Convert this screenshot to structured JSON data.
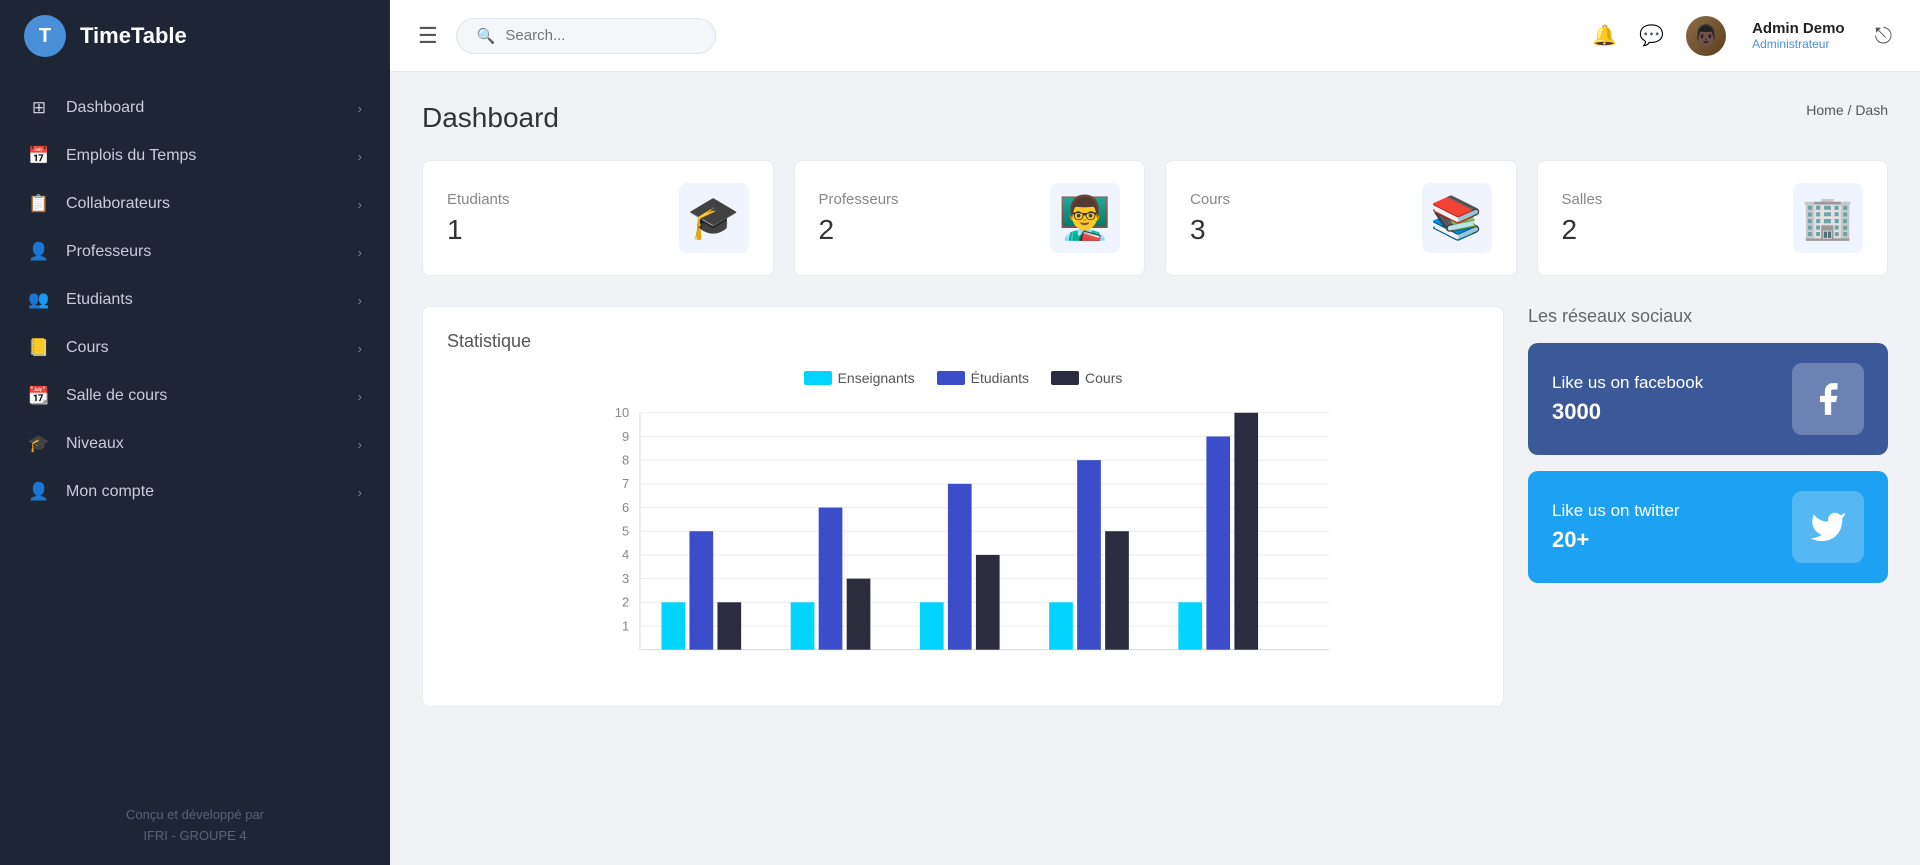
{
  "app": {
    "logo_letter": "T",
    "title": "TimeTable"
  },
  "sidebar": {
    "items": [
      {
        "id": "dashboard",
        "label": "Dashboard",
        "icon": "⊞"
      },
      {
        "id": "emplois",
        "label": "Emplois du Temps",
        "icon": "📅"
      },
      {
        "id": "collaborateurs",
        "label": "Collaborateurs",
        "icon": "📋"
      },
      {
        "id": "professeurs",
        "label": "Professeurs",
        "icon": "👤"
      },
      {
        "id": "etudiants",
        "label": "Etudiants",
        "icon": "👥"
      },
      {
        "id": "cours",
        "label": "Cours",
        "icon": "📒"
      },
      {
        "id": "salle",
        "label": "Salle de cours",
        "icon": "📆"
      },
      {
        "id": "niveaux",
        "label": "Niveaux",
        "icon": "🎓"
      },
      {
        "id": "compte",
        "label": "Mon compte",
        "icon": "👤"
      }
    ],
    "footer_line1": "Conçu et développé par",
    "footer_line2": "IFRI - GROUPE 4"
  },
  "topbar": {
    "search_placeholder": "Search...",
    "user_name": "Admin Demo",
    "user_role": "Administrateur"
  },
  "page": {
    "title": "Dashboard",
    "breadcrumb_home": "Home",
    "breadcrumb_sep": "/",
    "breadcrumb_current": "Dash"
  },
  "stats": [
    {
      "label": "Etudiants",
      "value": "1",
      "emoji": "🎓"
    },
    {
      "label": "Professeurs",
      "value": "2",
      "emoji": "👨‍🏫"
    },
    {
      "label": "Cours",
      "value": "3",
      "emoji": "📚"
    },
    {
      "label": "Salles",
      "value": "2",
      "emoji": "🏢"
    }
  ],
  "chart": {
    "title": "Statistique",
    "legend": [
      {
        "label": "Enseignants",
        "color": "#00d4ff"
      },
      {
        "label": "Étudiants",
        "color": "#3b4dc8"
      },
      {
        "label": "Cours",
        "color": "#2c2c3e"
      }
    ],
    "y_max": 10,
    "y_labels": [
      "10",
      "9",
      "8",
      "7",
      "6",
      "5",
      "4",
      "3",
      "2",
      "1"
    ],
    "groups": [
      {
        "enseignants": 2,
        "etudiants": 5,
        "cours": 2
      },
      {
        "enseignants": 2,
        "etudiants": 6,
        "cours": 3
      },
      {
        "enseignants": 2,
        "etudiants": 7,
        "cours": 4
      },
      {
        "enseignants": 2,
        "etudiants": 8,
        "cours": 5
      },
      {
        "enseignants": 2,
        "etudiants": 9,
        "cours": 10
      }
    ]
  },
  "social": {
    "title": "Les réseaux sociaux",
    "facebook": {
      "label": "Like us on facebook",
      "count": "3000",
      "icon": "f"
    },
    "twitter": {
      "label": "Like us on twitter",
      "count": "20+",
      "icon": "t"
    }
  }
}
